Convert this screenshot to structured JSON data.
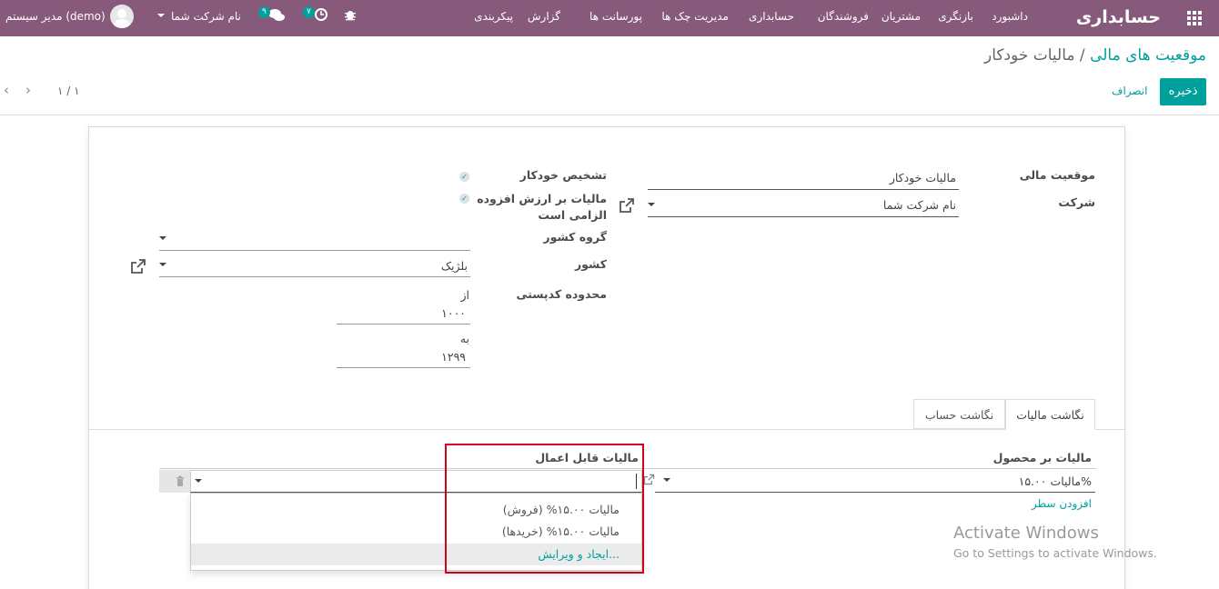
{
  "topbar": {
    "brand": "حسابداری",
    "menu": [
      "داشبورد",
      "بازنگری",
      "مشتریان",
      "فروشندگان",
      "حسابداری",
      "مدیریت چک ها",
      "پورسانت ها",
      "گزارش",
      "پیکربندی"
    ],
    "messages_count": "۹",
    "activities_count": "۷",
    "company_switcher": "نام شرکت شما",
    "user": "مدیر سیستم (demo)",
    "icons": [
      "apps-grid-icon",
      "bug-icon",
      "clock-icon",
      "chat-icon",
      "avatar"
    ]
  },
  "control": {
    "breadcrumb_parent": "موقعیت های مالی",
    "breadcrumb_sep": "/",
    "breadcrumb_current": "مالیات خودکار",
    "save": "ذخیره",
    "discard": "انصراف",
    "pager": "۱ / ۱"
  },
  "form": {
    "fiscal_position_label": "موقعیت مالی",
    "fiscal_position_value": "مالیات خودکار",
    "company_label": "شرکت",
    "company_value": "نام شرکت شما",
    "auto_detect_label": "تشخیص خودکار",
    "vat_required_label_1": "مالیات بر ارزش افزوده",
    "vat_required_label_2": "الزامی است",
    "country_group_label": "گروه کشور",
    "country_label": "کشور",
    "country_value": "بلژیک",
    "zip_range_label": "محدوده کدپستی",
    "zip_from_label": "از",
    "zip_from_value": "۱۰۰۰",
    "zip_to_label": "به",
    "zip_to_value": "۱۲۹۹"
  },
  "tabs": [
    "نگاشت مالیات",
    "نگاشت حساب"
  ],
  "tax_table": {
    "col_product_tax": "مالیات بر محصول",
    "col_applicable_tax": "مالیات قابل اعمال",
    "row_product_tax": "مالیات ۱۵.۰۰%",
    "add_line": "افزودن سطر"
  },
  "dropdown": {
    "options": [
      "مالیات ۱۵.۰۰% (فروش)",
      "مالیات ۱۵.۰۰% (خریدها)"
    ],
    "create_edit": "ایجاد و ویرایش..."
  },
  "watermark": {
    "line1": "Activate Windows",
    "line2": "Go to Settings to activate Windows."
  },
  "colors": {
    "brand": "#875a7b",
    "accent": "#00a09d",
    "highlight_box": "#d0021b"
  }
}
